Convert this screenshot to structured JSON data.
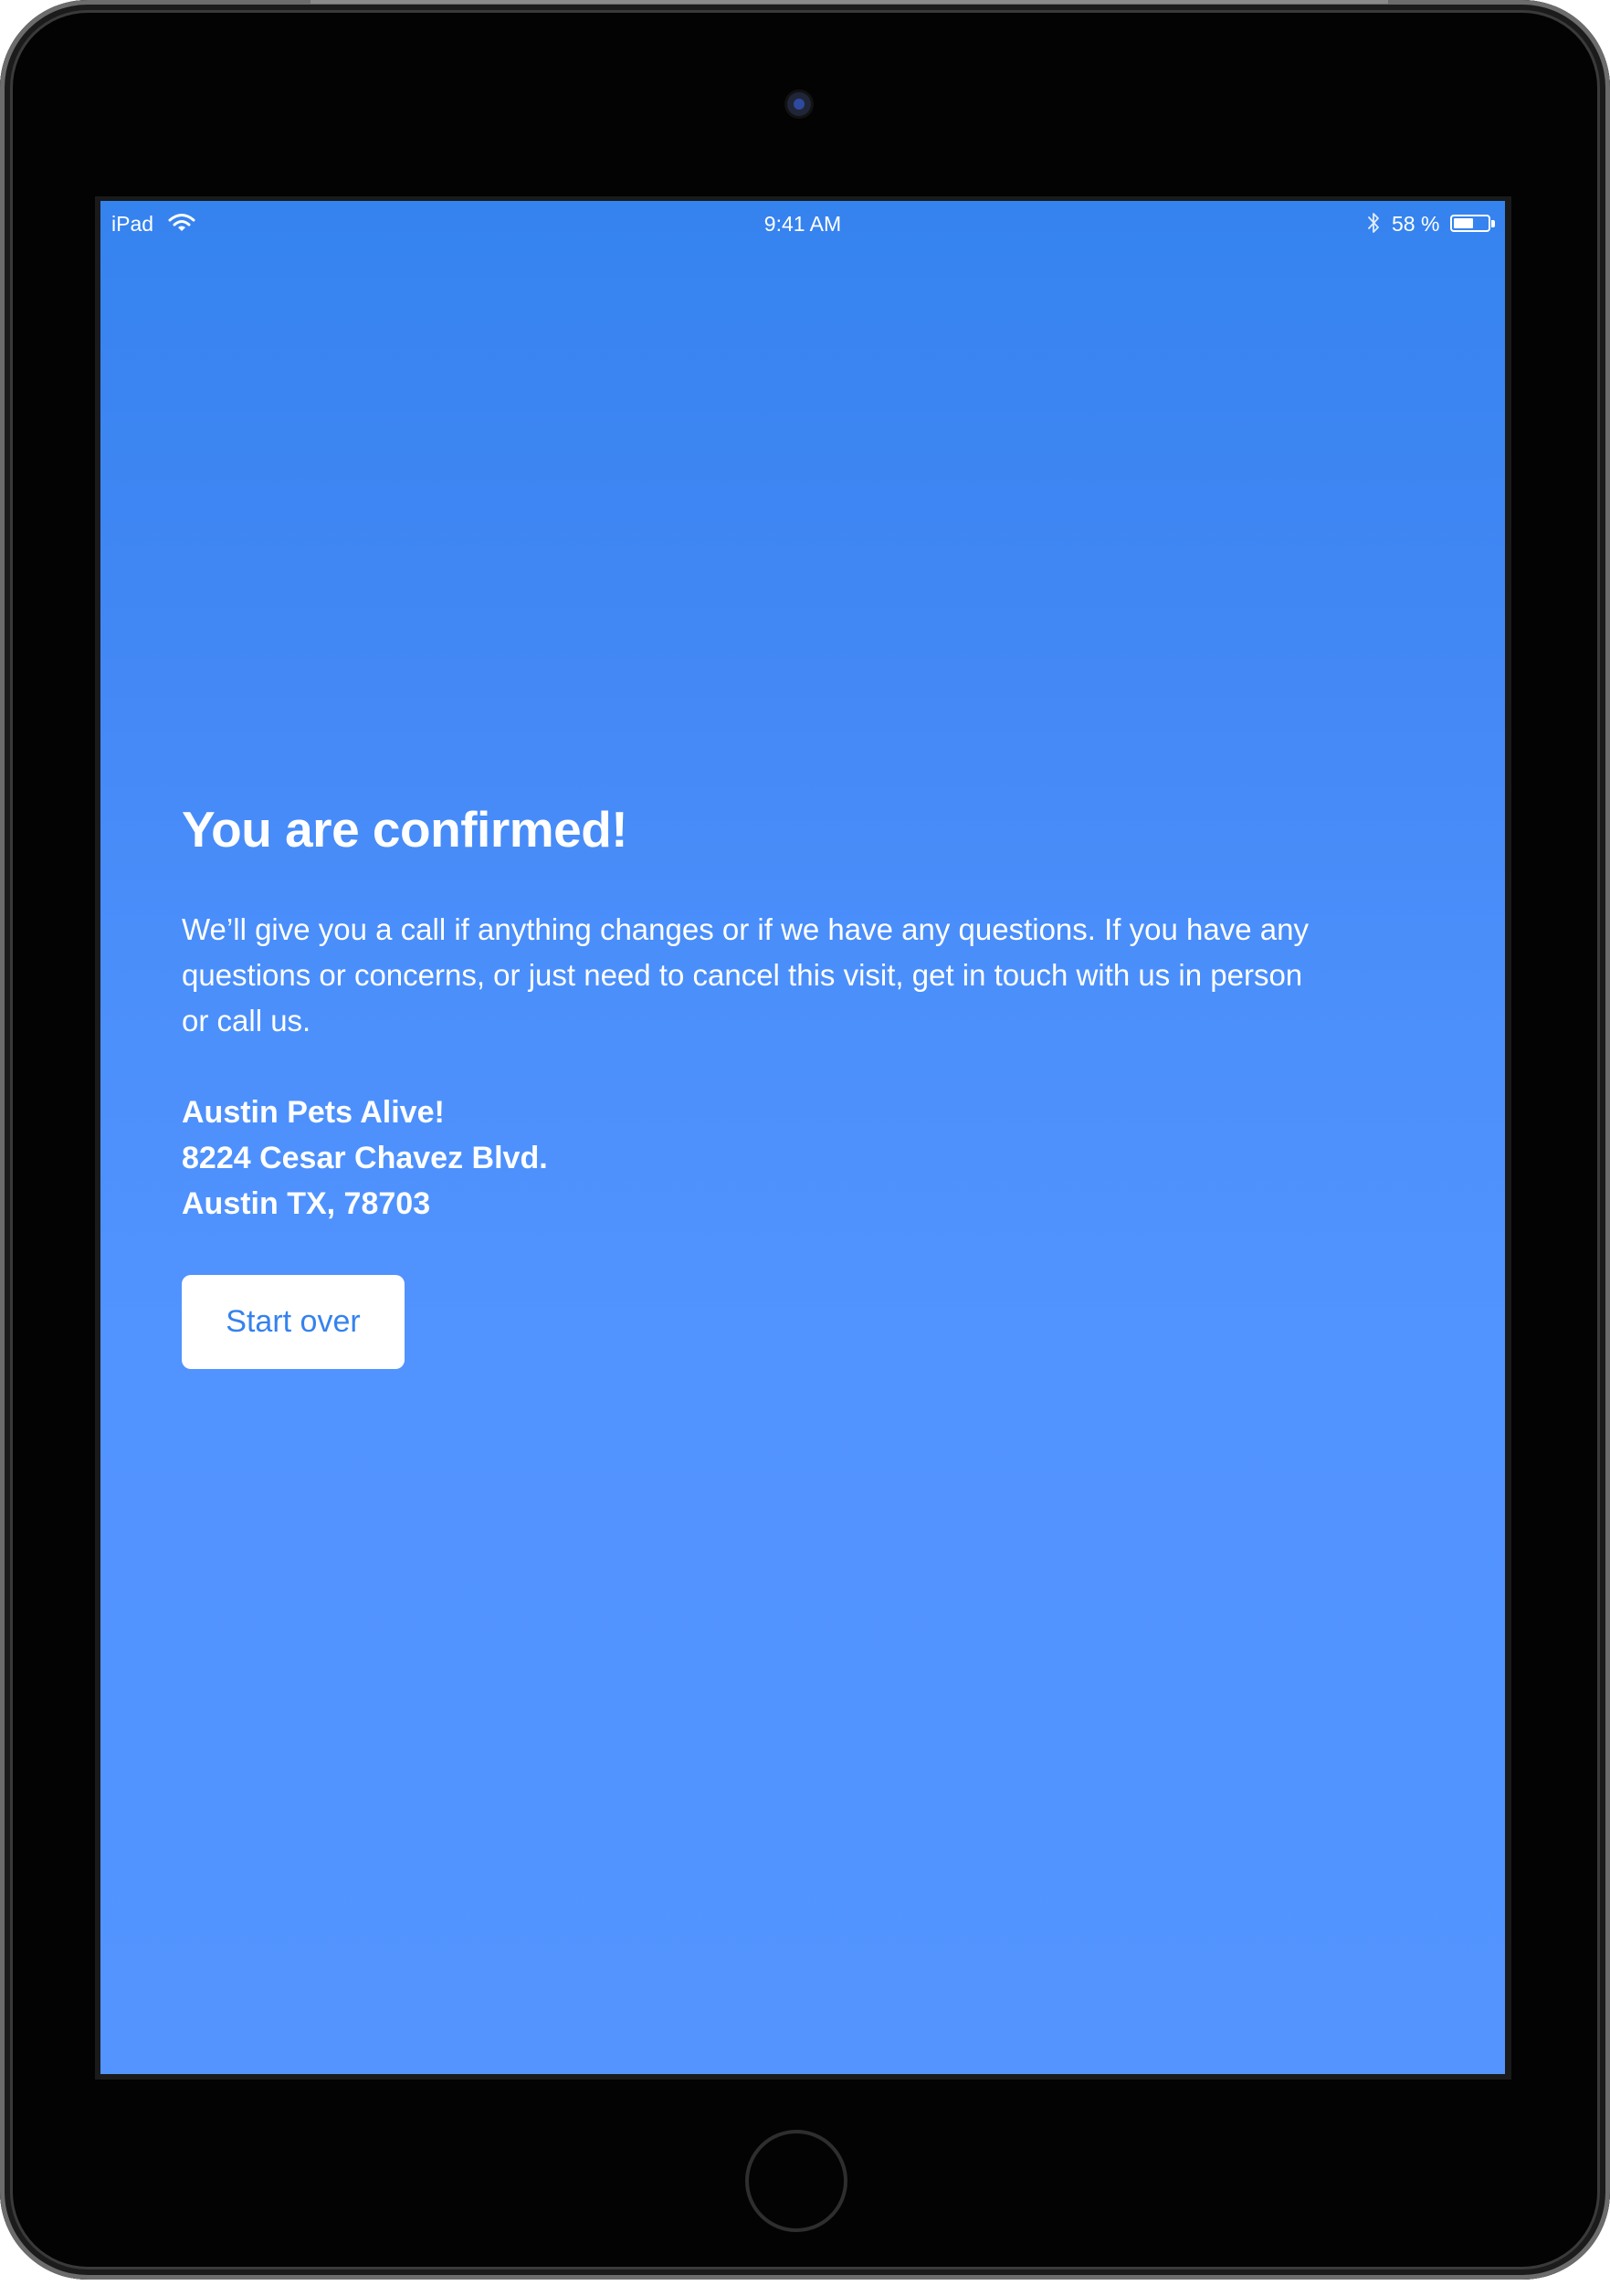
{
  "status_bar": {
    "carrier": "iPad",
    "time": "9:41 AM",
    "battery_text": "58 %",
    "battery_level": 0.58,
    "icons": [
      "wifi-icon",
      "bluetooth-icon",
      "battery-icon"
    ]
  },
  "confirmation": {
    "title": "You are confirmed!",
    "message": "We’ll give you a call if anything changes or if we have any questions. If you have any questions or concerns, or just need to cancel this visit, get in touch with us in person or call us.",
    "address": {
      "name": "Austin Pets Alive!",
      "street": "8224 Cesar Chavez Blvd.",
      "city": "Austin TX, 78703"
    },
    "start_over_label": "Start over"
  },
  "colors": {
    "background_top": "#3583ef",
    "background_bottom": "#5394ff",
    "button_text": "#3582ee",
    "button_background": "#ffffff",
    "text": "#ffffff"
  }
}
